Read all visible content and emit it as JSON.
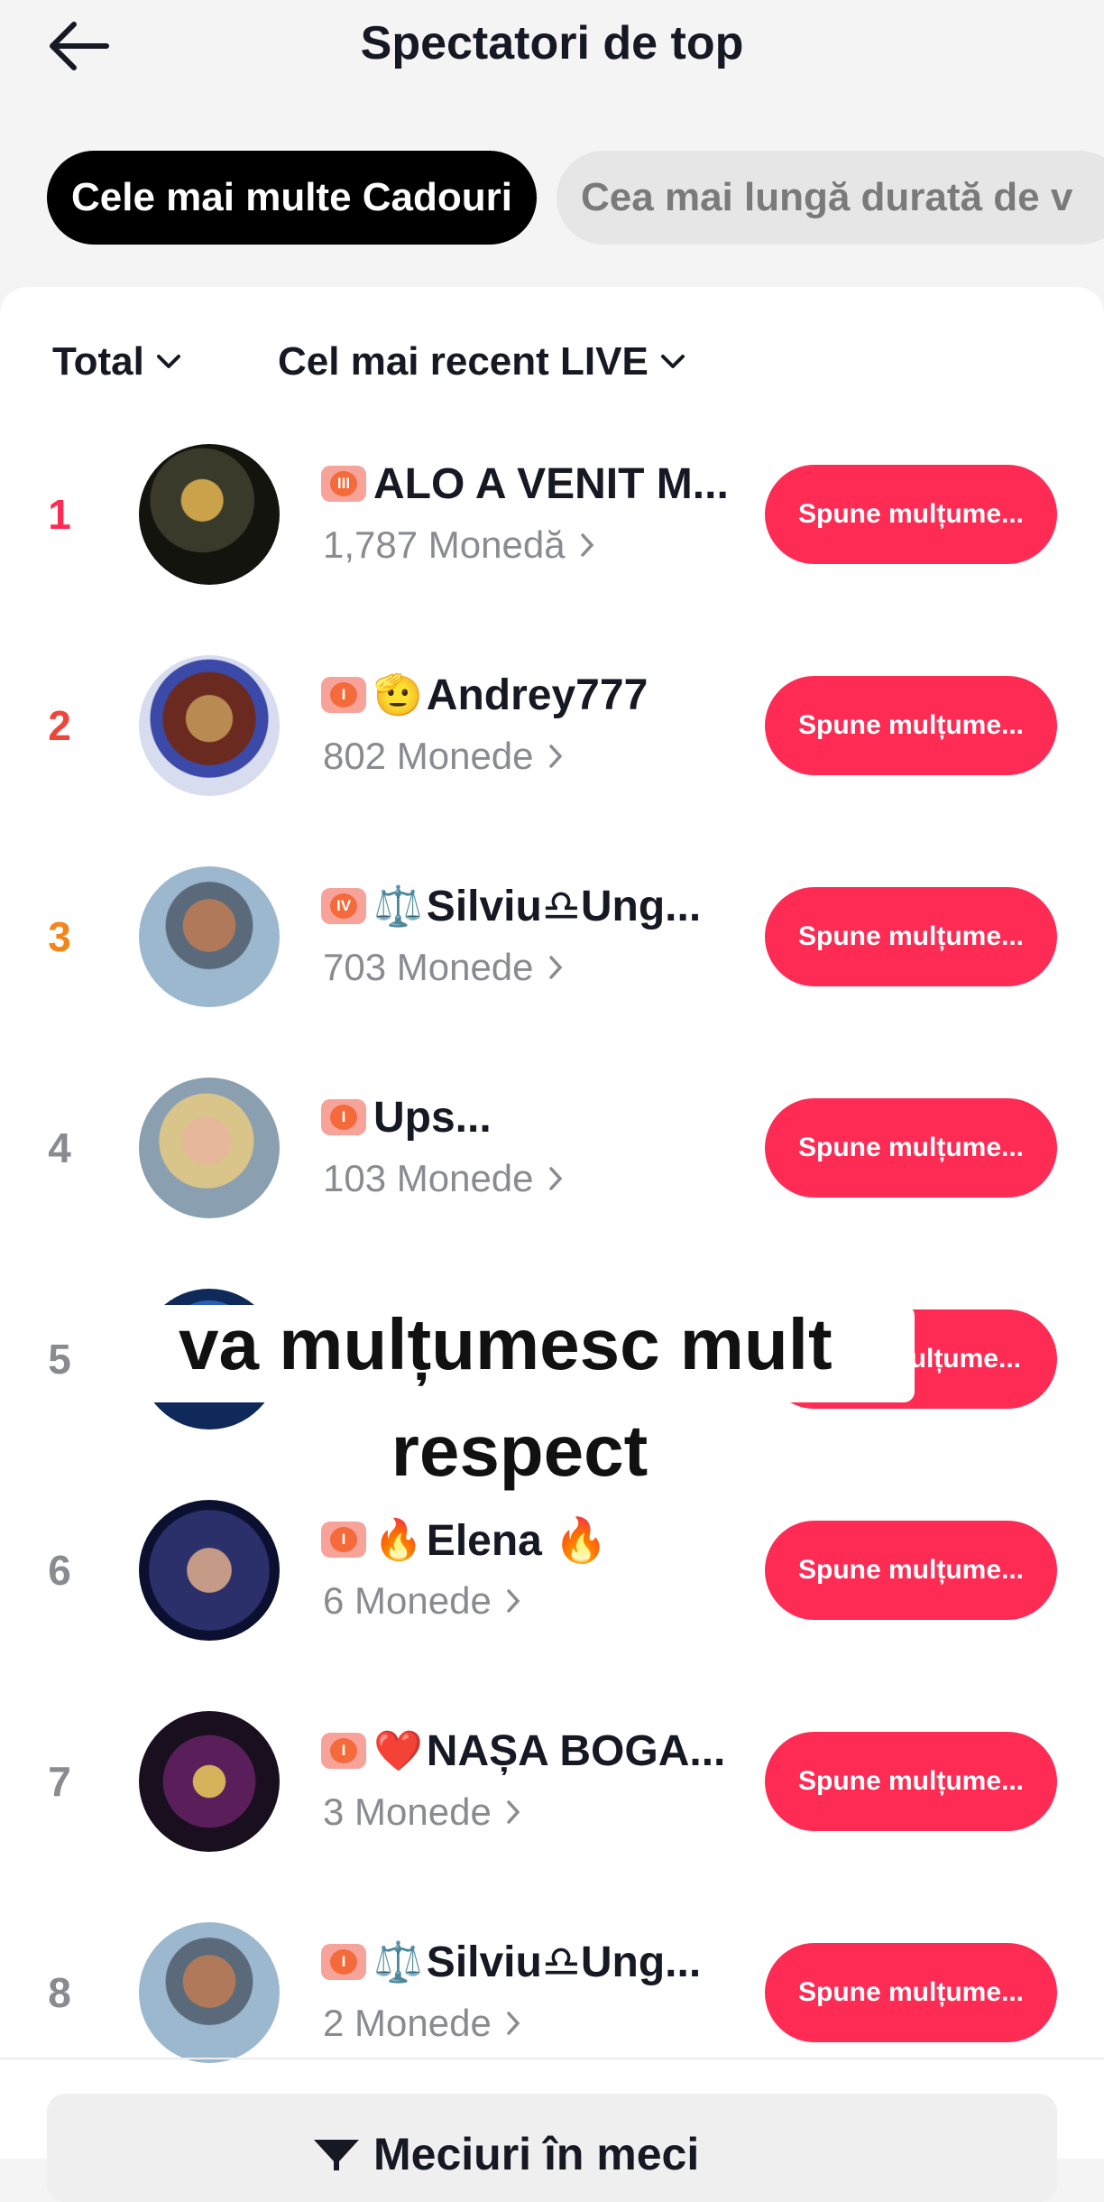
{
  "header": {
    "title": "Spectatori de top"
  },
  "tabs": [
    {
      "label": "Cele mai multe Cadouri"
    },
    {
      "label": "Cea mai lungă durată de v"
    }
  ],
  "filters": {
    "period": "Total",
    "live": "Cel mai recent LIVE"
  },
  "rows": [
    {
      "rank": "1",
      "rank_color": "#fe2c55",
      "badge": "III",
      "emoji": "",
      "name": "ALO A VENIT M...",
      "coins": "1,787 Monedă",
      "button": "Spune mulțume..."
    },
    {
      "rank": "2",
      "rank_color": "#f0453a",
      "badge": "I",
      "emoji": "🫡",
      "name": "Andrey777",
      "coins": "802 Monede",
      "button": "Spune mulțume..."
    },
    {
      "rank": "3",
      "rank_color": "#f3861a",
      "badge": "IV",
      "emoji": "⚖️",
      "name": "Silviu♎Ung...",
      "coins": "703 Monede",
      "button": "Spune mulțume..."
    },
    {
      "rank": "4",
      "rank_color": "#8a8b91",
      "badge": "I",
      "emoji": "",
      "name": "Ups...",
      "coins": "103 Monede",
      "button": "Spune mulțume..."
    },
    {
      "rank": "5",
      "rank_color": "#8a8b91",
      "badge": "",
      "emoji": "",
      "name": "",
      "coins": "",
      "button": "ulțume..."
    },
    {
      "rank": "6",
      "rank_color": "#8a8b91",
      "badge": "I",
      "emoji": "🔥",
      "name": "Elena 🔥",
      "coins": "6 Monede",
      "button": "Spune mulțume..."
    },
    {
      "rank": "7",
      "rank_color": "#8a8b91",
      "badge": "I",
      "emoji": "❤️",
      "name": "NAȘA BOGA...",
      "coins": "3 Monede",
      "button": "Spune mulțume..."
    },
    {
      "rank": "8",
      "rank_color": "#8a8b91",
      "badge": "I",
      "emoji": "⚖️",
      "name": "Silviu♎Ung...",
      "coins": "2 Monede",
      "button": "Spune mulțume..."
    }
  ],
  "overlay": {
    "line1": "va mulțumesc mult",
    "line2": "respect"
  },
  "bottom": {
    "label": "Meciuri în meci"
  },
  "colors": {
    "accent": "#fe2c55",
    "muted": "#8a8b91"
  }
}
